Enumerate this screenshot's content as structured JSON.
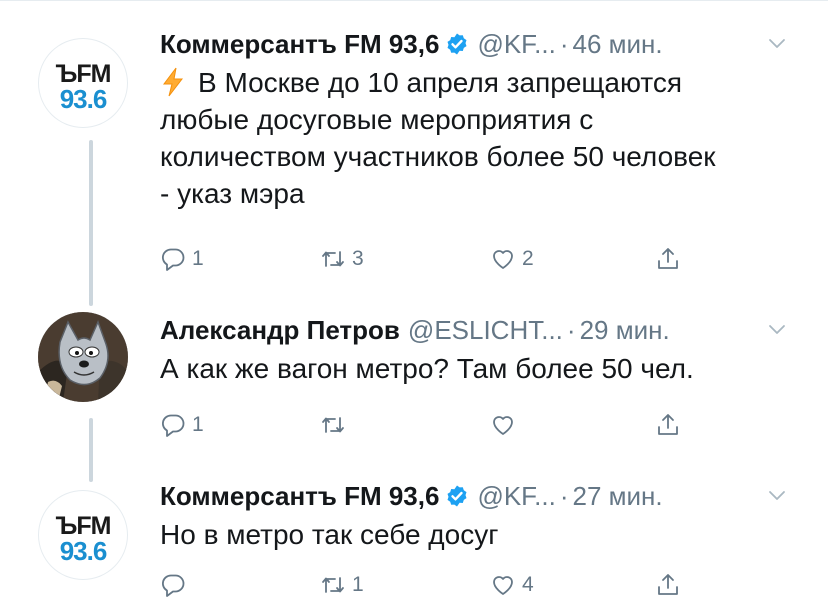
{
  "tweets": [
    {
      "avatar": {
        "line1": "ЪFM",
        "line2": "93.6"
      },
      "name": "Коммерсантъ FM 93,6",
      "verified": true,
      "handle": "@KF...",
      "time": "46 мин.",
      "lines": [
        "В Москве до 10 апреля запрещаются",
        "любые досуговые мероприятия с",
        "количеством участников более 50 человек",
        "- указ мэра"
      ],
      "reply_count": "1",
      "retweet_count": "3",
      "like_count": "2"
    },
    {
      "name": "Александр Петров",
      "handle": "@ESLICHT...",
      "time": "29 мин.",
      "lines": [
        "А как же вагон метро? Там более 50 чел."
      ],
      "reply_count": "1",
      "retweet_count": "",
      "like_count": ""
    },
    {
      "avatar": {
        "line1": "ЪFM",
        "line2": "93.6"
      },
      "name": "Коммерсантъ FM 93,6",
      "verified": true,
      "handle": "@KF...",
      "time": "27 мин.",
      "lines": [
        "Но в метро так себе досуг"
      ],
      "reply_count": "",
      "retweet_count": "1",
      "like_count": "4"
    }
  ],
  "colors": {
    "text": "#14171a",
    "muted": "#657786",
    "verified": "#1da1f2",
    "thread": "#ccd6dd",
    "bolt": "#ffac33",
    "logo_blue": "#1a8fd0"
  },
  "icons": [
    "bolt-icon",
    "verified-icon",
    "chevron-down-icon",
    "reply-icon",
    "retweet-icon",
    "like-icon",
    "share-icon"
  ]
}
